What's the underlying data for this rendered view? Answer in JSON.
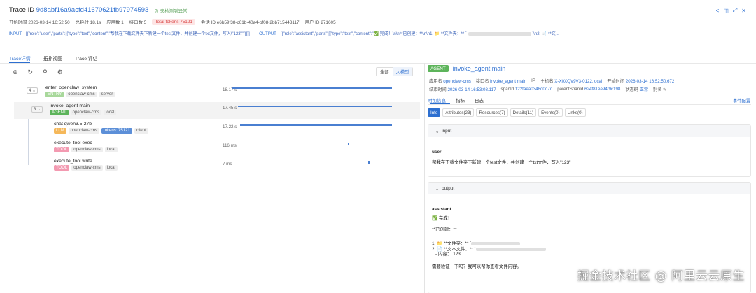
{
  "header": {
    "label": "Trace ID",
    "trace_id": "9d8abf16a9acfd41670621fb97974593",
    "status": "未检测到异常",
    "meta": [
      {
        "k": "开始时间",
        "v": "2026-03-14 16:52:50"
      },
      {
        "k": "总耗时",
        "v": "18.1s"
      },
      {
        "k": "应用数",
        "v": "1"
      },
      {
        "k": "接口数",
        "v": "5"
      }
    ],
    "total_tokens_label": "Total tokens",
    "total_tokens": "75121",
    "session_label": "会话 ID",
    "session_id": "e6b59f38-c61b-40a4-bf08-2bb715443117",
    "user_label": "用户 ID",
    "user_id": "271605",
    "input_label": "INPUT",
    "input_value": "[{\"role\":\"user\",\"parts\":[{\"type\":\"text\",\"content\":\"帮我在下载文件夹下新建一个test文件，并创建一个txt文件，写入\\\"123\\\"\"}]}]",
    "output_label": "OUTPUT",
    "output_value": "[{\"role\":\"assistant\",\"parts\":[{\"type\":\"text\",\"content\":\"✅ 完成！\\n\\n**已创建：**\\n\\n1. 📁 **文件夹：** `",
    "output_tail": "`\\n2. 📄 **文..."
  },
  "tabs": [
    "Trace详情",
    "拓扑视图",
    "Trace 评估"
  ],
  "view_toggle": [
    "全部",
    "大模型"
  ],
  "tree": [
    {
      "count": "4",
      "name": "enter_openclaw_system",
      "tags": [
        "ENTRY",
        "openclaw-cms",
        "server"
      ],
      "duration": "18.17 s"
    },
    {
      "count": "3",
      "name": "invoke_agent main",
      "tags": [
        "AGENT",
        "openclaw-cms",
        "local"
      ],
      "duration": "17.45 s"
    },
    {
      "count": "",
      "name": "chat qwen3.5-27b",
      "tags": [
        "LLM",
        "openclaw-cms",
        "tokens: 75121",
        "client"
      ],
      "duration": "17.22 s"
    },
    {
      "count": "",
      "name": "execute_tool exec",
      "tags": [
        "TOOL",
        "openclaw-cms",
        "local"
      ],
      "duration": "116 ms"
    },
    {
      "count": "",
      "name": "execute_tool write",
      "tags": [
        "TOOL",
        "openclaw-cms",
        "local"
      ],
      "duration": "7 ms"
    }
  ],
  "detail": {
    "tag": "AGENT",
    "title": "invoke_agent main",
    "kv1": [
      {
        "k": "应用名",
        "v": "openclaw-cms"
      },
      {
        "k": "接口名",
        "v": "invoke_agent main"
      },
      {
        "k": "IP",
        "v": ""
      },
      {
        "k": "主机名",
        "v": "X-X0XQV9V3-0122.local"
      },
      {
        "k": "开始时间",
        "v": "2026-03-14 16:52:50.672"
      }
    ],
    "kv2": [
      {
        "k": "结束时间",
        "v": "2026-03-14 16:53:08.117"
      },
      {
        "k": "spanId",
        "v": "122faea0348d0d7d"
      },
      {
        "k": "parentSpanId",
        "v": "624f81ee94f9c198"
      },
      {
        "k": "状态码",
        "v": "正常"
      },
      {
        "k": "别名",
        "v": ""
      }
    ],
    "tabs": [
      "附加信息",
      "指标",
      "日志"
    ],
    "events_config": "事件配置",
    "subtabs": [
      "Info",
      "Attributes(23)",
      "Resources(7)",
      "Details(11)",
      "Events(0)",
      "Links(0)"
    ],
    "input_title": "input",
    "input_role": "user",
    "input_text": "帮我在下载文件夹下新建一个test文件，并创建一个txt文件，写入\"123\"",
    "output_title": "output",
    "output_role": "assistant",
    "output_lines": [
      "✅ 完成！",
      "**已创建：**",
      "1. 📁 **文件夹：** `",
      "2. 📄 **文本文件：** `",
      "- 内容：`123`",
      "需要验证一下吗？我可以帮你查看文件内容。"
    ]
  },
  "watermark": "掘金技术社区 @ 阿里云云原生"
}
